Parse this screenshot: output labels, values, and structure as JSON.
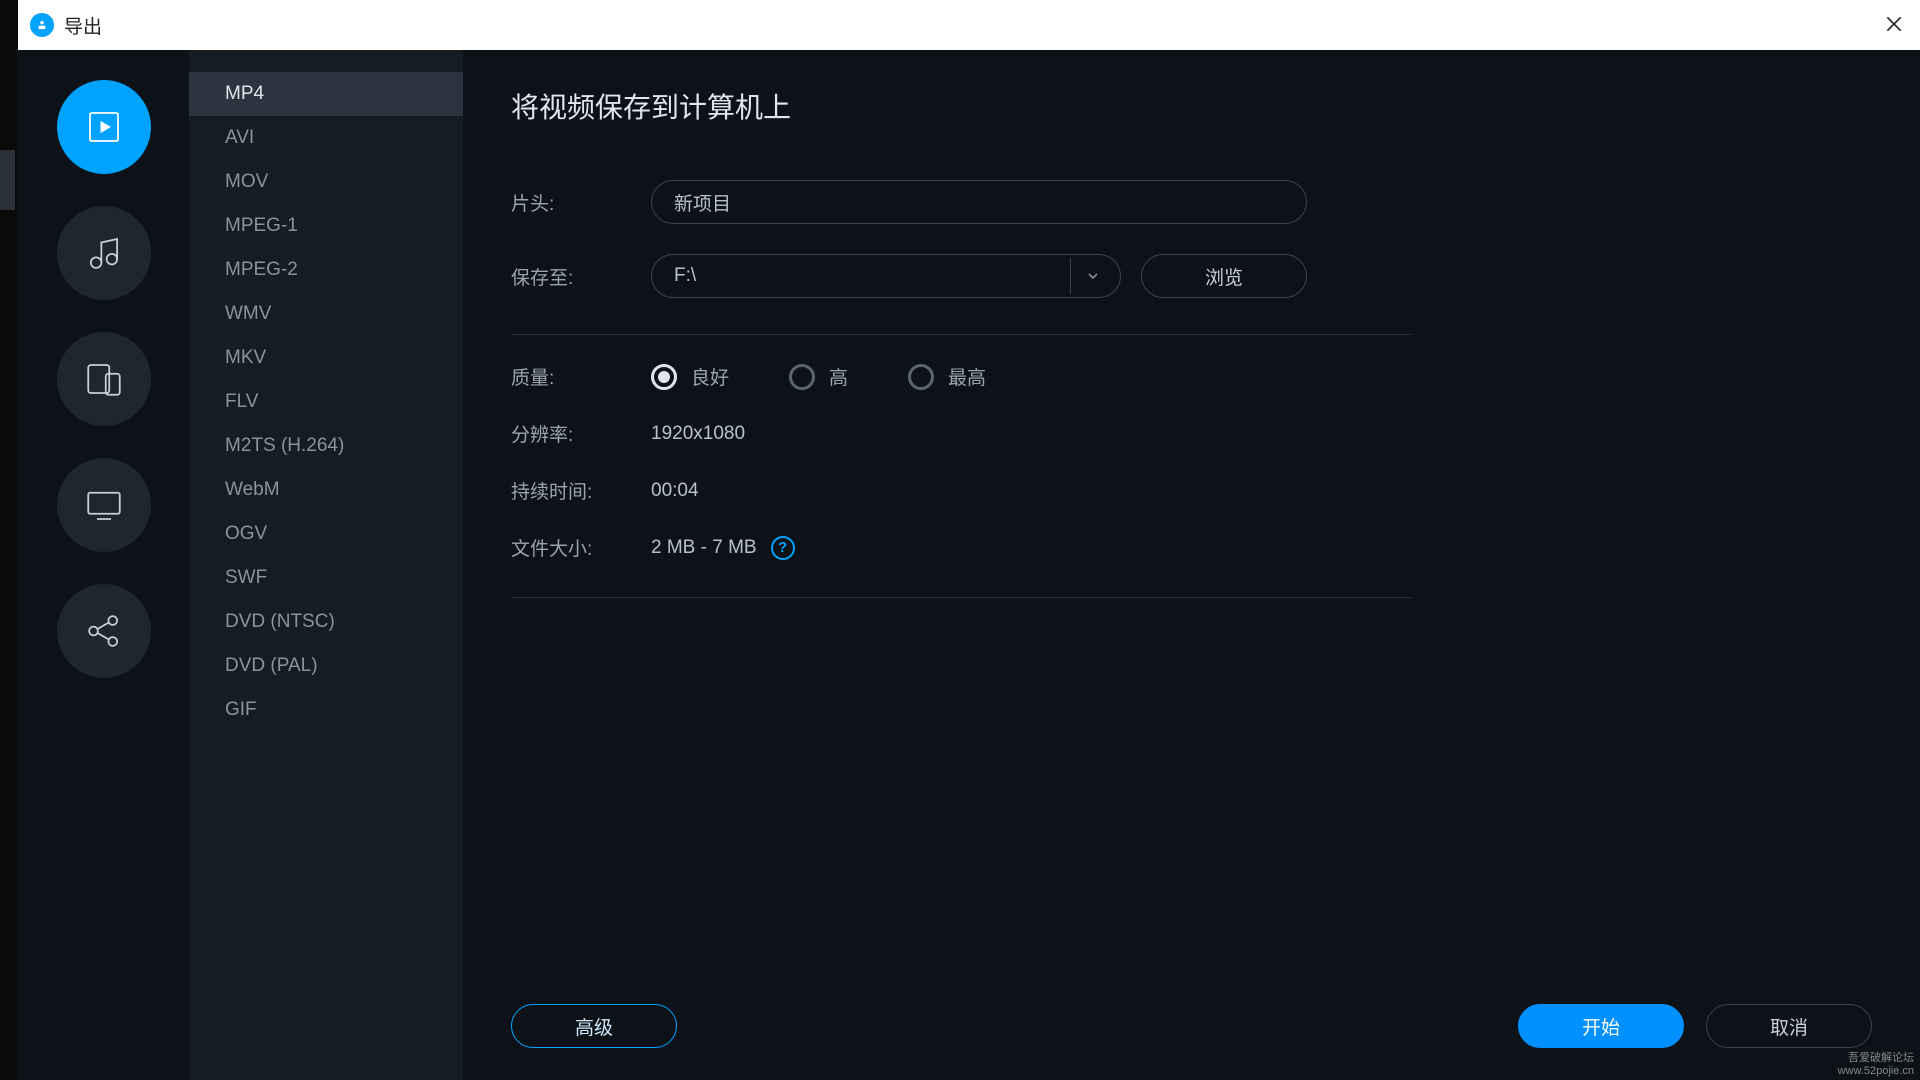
{
  "window": {
    "title": "导出"
  },
  "categories": [
    {
      "id": "video",
      "icon": "play",
      "active": true
    },
    {
      "id": "audio",
      "icon": "music",
      "active": false
    },
    {
      "id": "device",
      "icon": "devices",
      "active": false
    },
    {
      "id": "tv",
      "icon": "monitor",
      "active": false
    },
    {
      "id": "share",
      "icon": "share",
      "active": false
    }
  ],
  "formats": [
    {
      "label": "MP4",
      "active": true
    },
    {
      "label": "AVI"
    },
    {
      "label": "MOV"
    },
    {
      "label": "MPEG-1"
    },
    {
      "label": "MPEG-2"
    },
    {
      "label": "WMV"
    },
    {
      "label": "MKV"
    },
    {
      "label": "FLV"
    },
    {
      "label": "M2TS (H.264)"
    },
    {
      "label": "WebM"
    },
    {
      "label": "OGV"
    },
    {
      "label": "SWF"
    },
    {
      "label": "DVD (NTSC)"
    },
    {
      "label": "DVD (PAL)"
    },
    {
      "label": "GIF"
    }
  ],
  "main": {
    "heading": "将视频保存到计算机上",
    "title_label": "片头:",
    "title_value": "新项目",
    "saveto_label": "保存至:",
    "saveto_value": "F:\\",
    "browse_label": "浏览",
    "quality_label": "质量:",
    "quality_options": [
      "良好",
      "高",
      "最高"
    ],
    "quality_selected": 0,
    "resolution_label": "分辨率:",
    "resolution_value": "1920x1080",
    "duration_label": "持续时间:",
    "duration_value": "00:04",
    "filesize_label": "文件大小:",
    "filesize_value": "2 MB - 7 MB"
  },
  "buttons": {
    "advanced": "高级",
    "start": "开始",
    "cancel": "取消"
  },
  "watermark": {
    "line1": "吾爱破解论坛",
    "line2": "www.52pojie.cn"
  }
}
